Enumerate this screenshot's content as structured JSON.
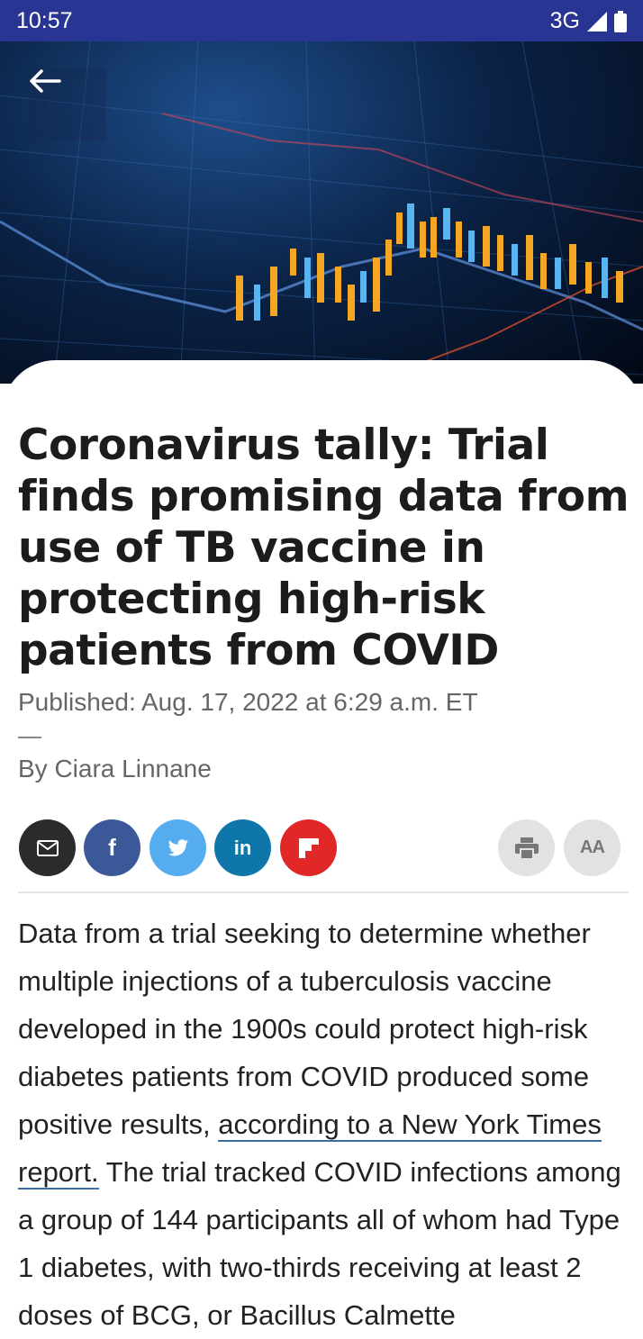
{
  "status_bar": {
    "time": "10:57",
    "network": "3G"
  },
  "header": {
    "back_icon": "arrow-left-icon"
  },
  "article": {
    "headline": "Coronavirus tally: Trial finds promising data from use of TB vaccine in protecting high-risk patients from COVID",
    "published": "Published: Aug. 17, 2022 at 6:29 a.m. ET",
    "byline": "By Ciara Linnane",
    "body_pre": "Data from a trial seeking to determine whether multiple injections of a tuberculosis vaccine developed in the 1900s could protect high-risk diabetes patients from COVID produced some positive results, ",
    "body_link": "according to a New York Times report.",
    "body_post": " The trial tracked COVID infections among a group of 144 participants all of whom had Type 1 diabetes, with two-thirds receiving at least 2 doses of BCG, or Bacillus Calmette"
  },
  "share": {
    "email": {
      "icon": "envelope-icon",
      "color": "#2b2b2b"
    },
    "facebook": {
      "icon": "facebook-icon",
      "label": "f",
      "color": "#3b5998"
    },
    "twitter": {
      "icon": "twitter-icon",
      "color": "#55acee"
    },
    "linkedin": {
      "icon": "linkedin-icon",
      "label": "in",
      "color": "#0e76a8"
    },
    "flipboard": {
      "icon": "flipboard-icon",
      "color": "#e12828"
    },
    "print": {
      "icon": "printer-icon",
      "color": "#e2e2e2"
    },
    "text_size": {
      "icon": "text-size-icon",
      "label": "AA",
      "color": "#e2e2e2"
    }
  }
}
